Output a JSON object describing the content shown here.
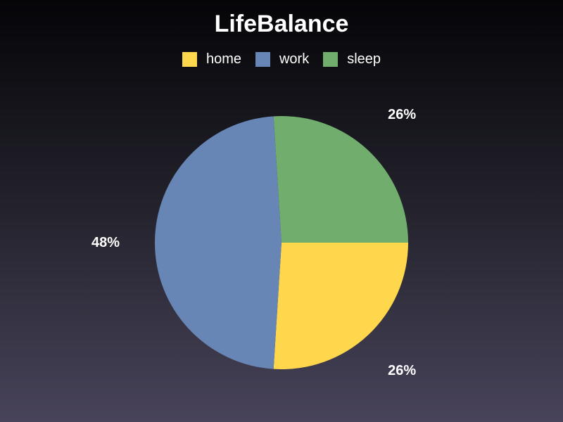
{
  "chart_data": {
    "type": "pie",
    "title": "LifeBalance",
    "legend_placement": "top",
    "categories": [
      "home",
      "work",
      "sleep"
    ],
    "values": [
      26,
      48,
      26
    ],
    "value_labels": [
      "26%",
      "48%",
      "26%"
    ],
    "colors": [
      "#ffd74c",
      "#6786b5",
      "#71ae6e"
    ]
  }
}
